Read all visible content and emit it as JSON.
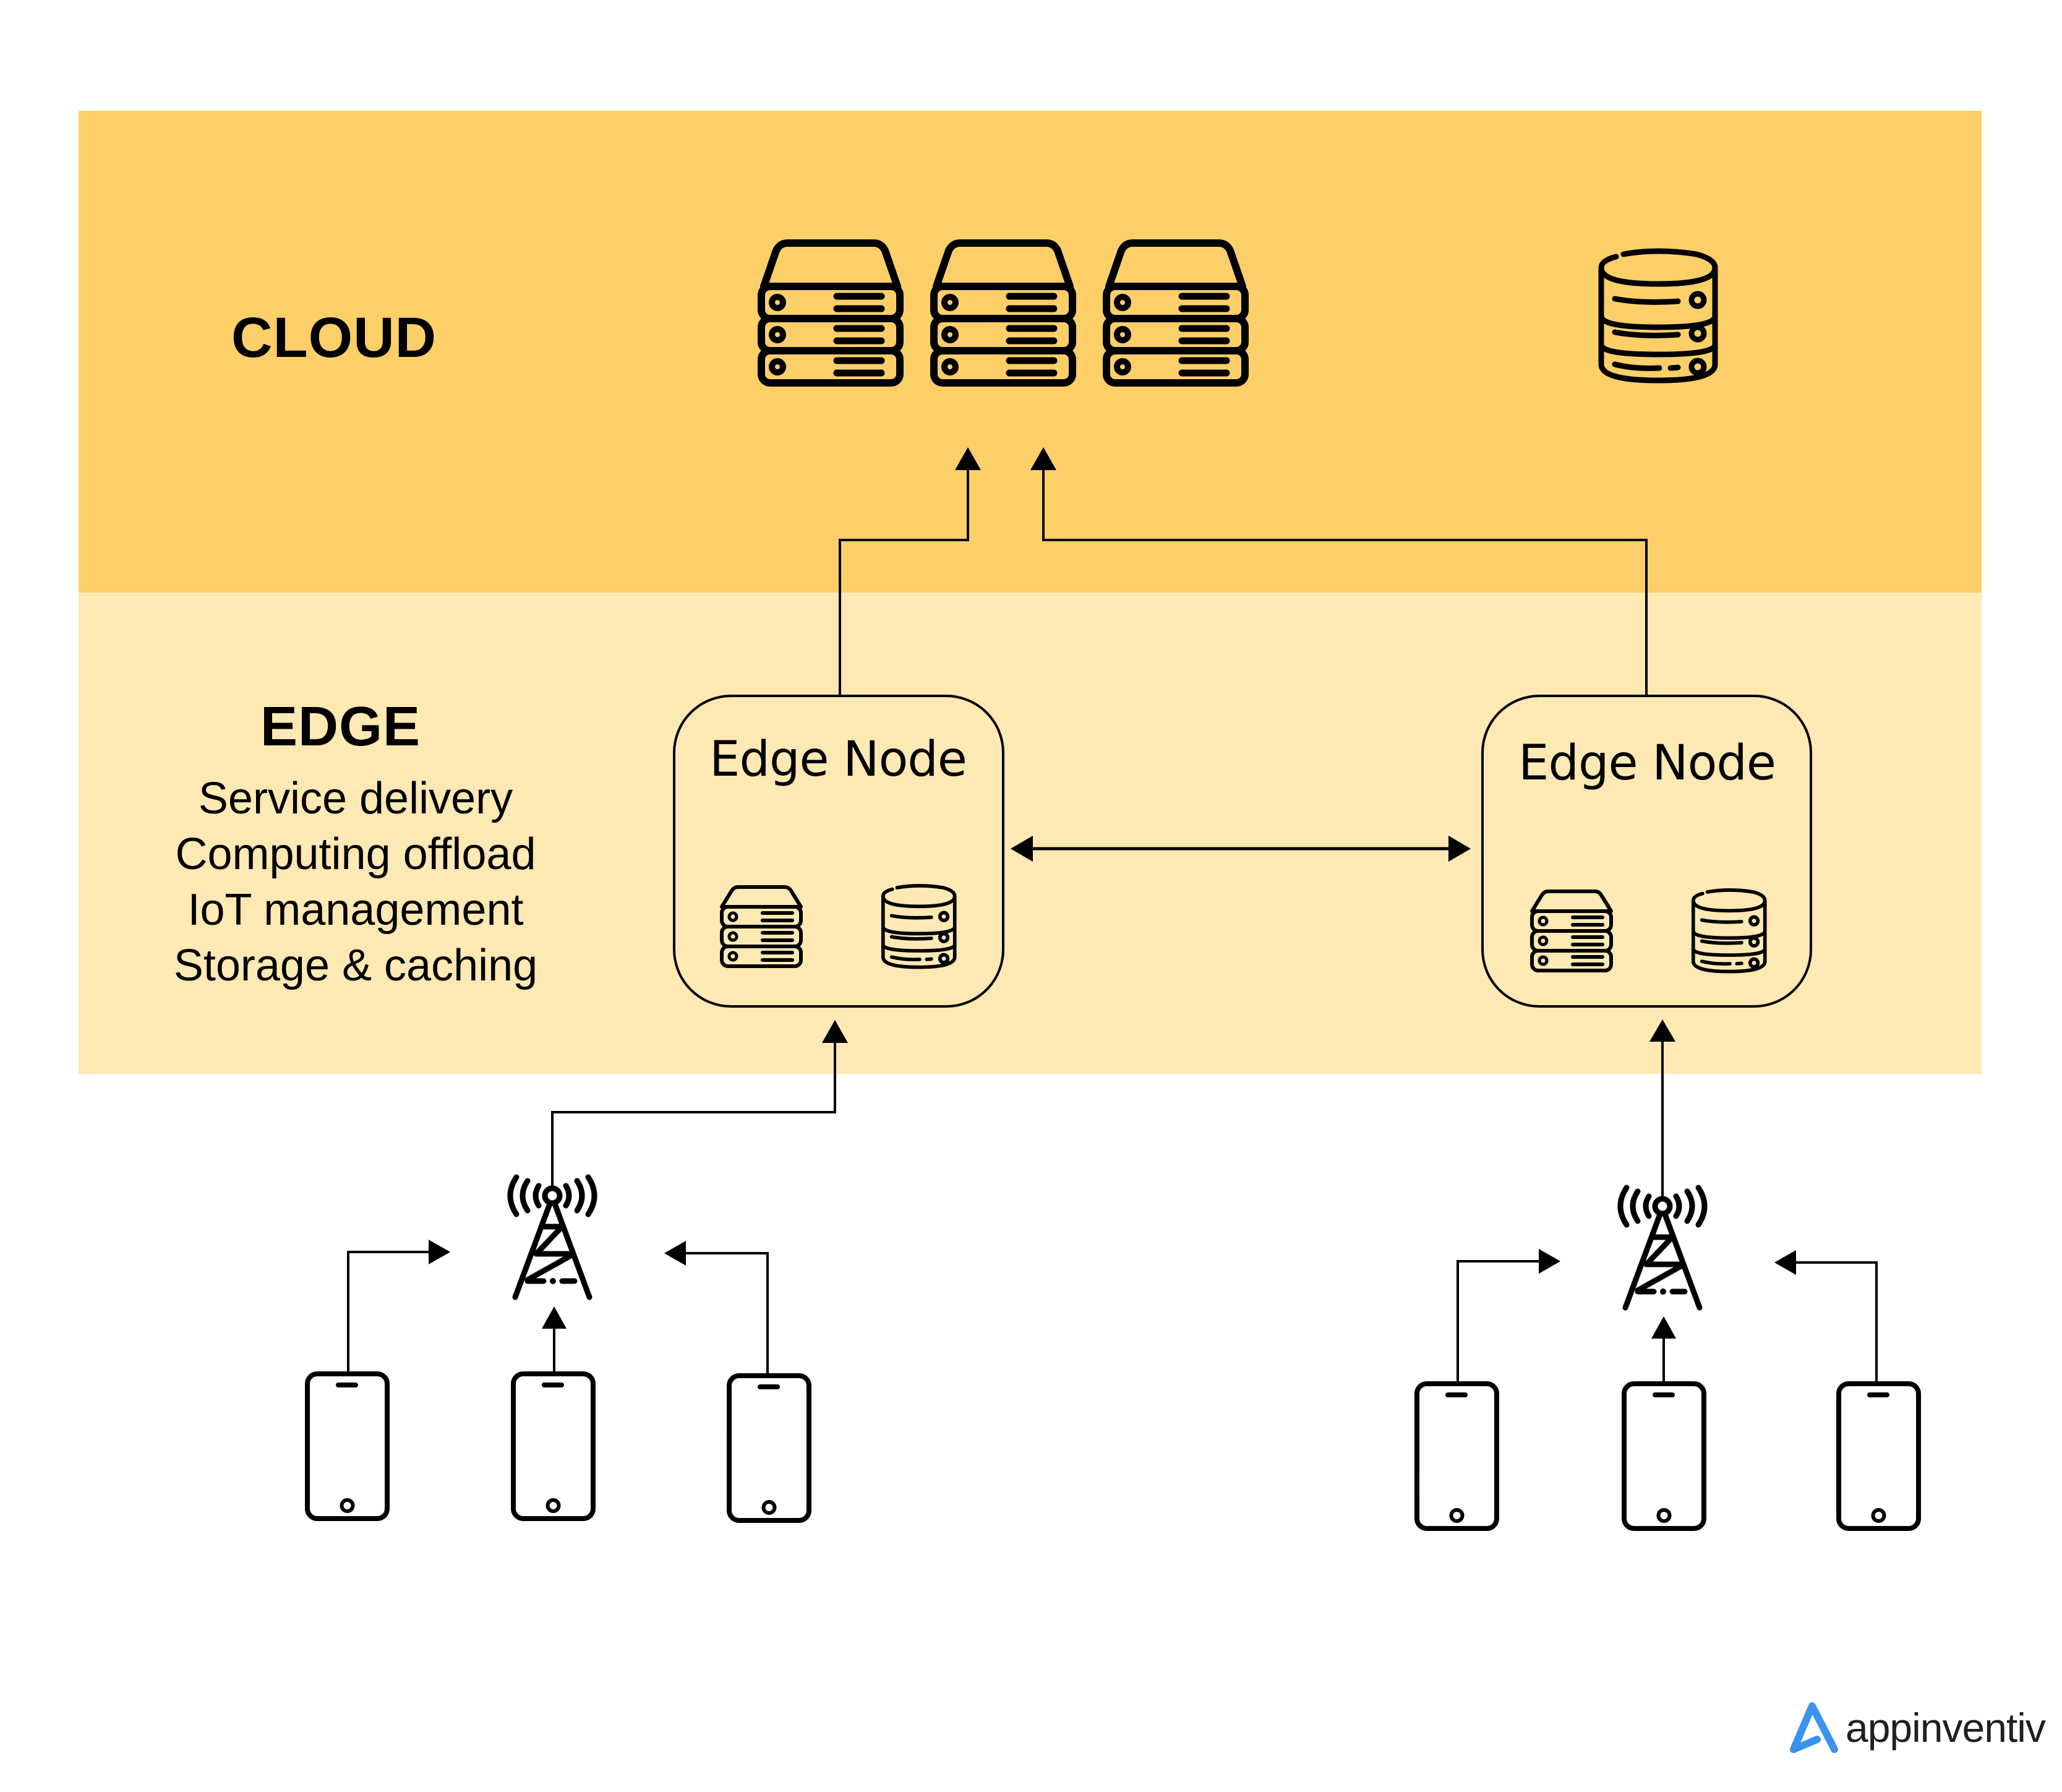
{
  "layers": {
    "cloud": {
      "title": "CLOUD",
      "background": "#FDCF69"
    },
    "edge": {
      "title": "EDGE",
      "background": "#FEE8B3",
      "features": [
        "Service delivery",
        "Computing offload",
        "IoT management",
        "Storage & caching"
      ]
    }
  },
  "cloud_icons": [
    "server-rack-icon",
    "server-rack-icon",
    "server-rack-icon",
    "database-icon"
  ],
  "edge_nodes": [
    {
      "label": "Edge Node",
      "icons": [
        "server-rack-icon",
        "database-icon"
      ]
    },
    {
      "label": "Edge Node",
      "icons": [
        "server-rack-icon",
        "database-icon"
      ]
    }
  ],
  "device_groups": [
    {
      "tower": "cell-tower-icon",
      "devices": [
        "smartphone-icon",
        "smartphone-icon",
        "smartphone-icon"
      ]
    },
    {
      "tower": "cell-tower-icon",
      "devices": [
        "smartphone-icon",
        "smartphone-icon",
        "smartphone-icon"
      ]
    }
  ],
  "connections": [
    {
      "from": "edge-node-left",
      "to": "cloud",
      "type": "arrow"
    },
    {
      "from": "edge-node-right",
      "to": "cloud",
      "type": "arrow"
    },
    {
      "from": "edge-node-left",
      "to": "edge-node-right",
      "type": "bidirectional"
    },
    {
      "from": "tower-left",
      "to": "edge-node-left",
      "type": "arrow"
    },
    {
      "from": "tower-right",
      "to": "edge-node-right",
      "type": "arrow"
    },
    {
      "from": "phones-left",
      "to": "tower-left",
      "type": "arrow"
    },
    {
      "from": "phones-right",
      "to": "tower-right",
      "type": "arrow"
    }
  ],
  "branding": {
    "logo_text": "appinventiv",
    "logo_color": "#3A93F0",
    "text_color": "#1f1f1f"
  }
}
